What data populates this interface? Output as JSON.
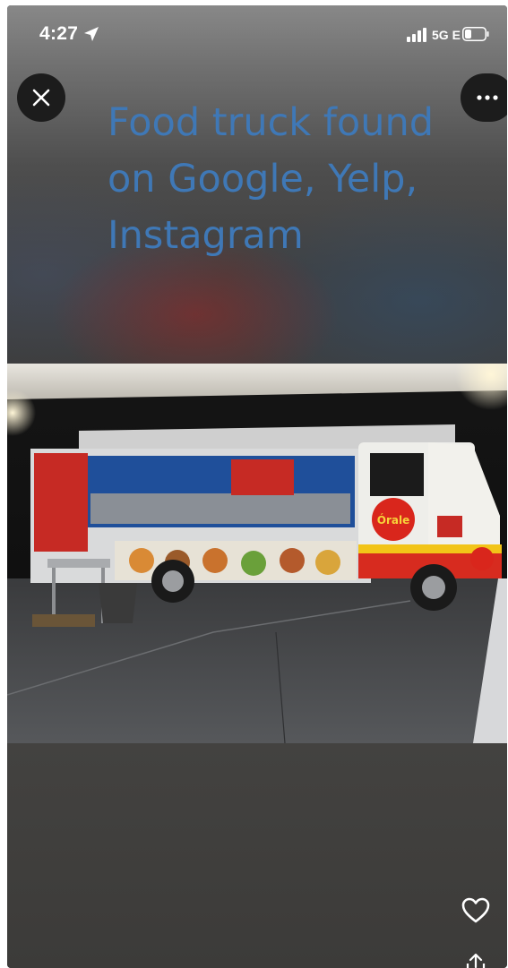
{
  "status_bar": {
    "time": "4:27",
    "network": "5G E",
    "icons": [
      "location-arrow-icon",
      "signal-bars-icon",
      "battery-icon"
    ]
  },
  "toolbar": {
    "close_icon": "close-icon",
    "more_icon": "more-options-icon"
  },
  "post": {
    "caption": "Food truck found on Google, Yelp, Instagram",
    "caption_color": "#3f78b6"
  },
  "photo": {
    "subject": "food-truck-photo",
    "truck_logo_text": "Órale"
  },
  "actions": {
    "like_icon": "heart-icon",
    "share_icon": "share-icon"
  }
}
